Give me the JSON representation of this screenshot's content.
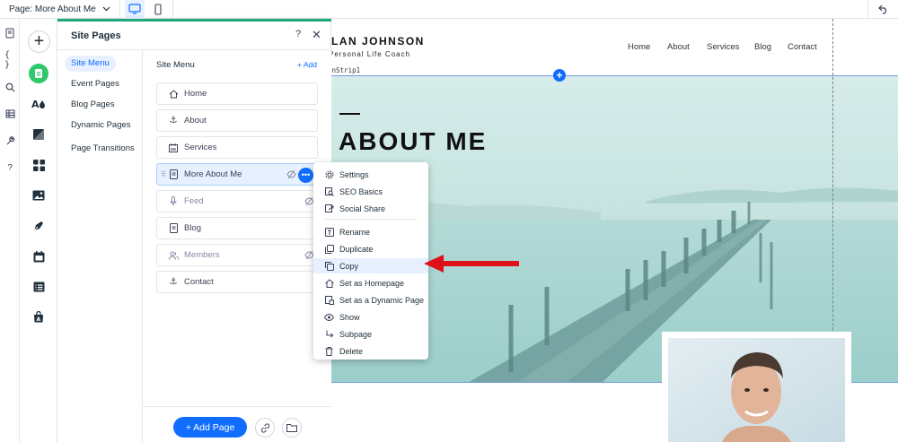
{
  "topbar": {
    "page_label": "Page: More About Me"
  },
  "panel": {
    "title": "Site Pages",
    "help": "?",
    "close": "✕",
    "nav": [
      {
        "label": "Site Menu",
        "active": true
      },
      {
        "label": "Event Pages"
      },
      {
        "label": "Blog Pages"
      },
      {
        "label": "Dynamic Pages"
      },
      {
        "label": "Page Transitions"
      }
    ],
    "main_heading": "Site Menu",
    "add_link": "+ Add",
    "pages": [
      {
        "label": "Home",
        "icon": "home-icon"
      },
      {
        "label": "About",
        "icon": "anchor-icon"
      },
      {
        "label": "Services",
        "icon": "calendar-icon"
      },
      {
        "label": "More About Me",
        "icon": "page-icon",
        "selected": true
      },
      {
        "label": "Feed",
        "icon": "mic-icon",
        "hidden": true
      },
      {
        "label": "Blog",
        "icon": "page-icon"
      },
      {
        "label": "Members",
        "icon": "members-icon",
        "hidden": true
      },
      {
        "label": "Contact",
        "icon": "anchor-icon"
      }
    ],
    "add_page_button": "+ Add Page"
  },
  "context_menu": {
    "items": [
      {
        "label": "Settings",
        "icon": "gear-icon"
      },
      {
        "label": "SEO Basics",
        "icon": "seo-icon"
      },
      {
        "label": "Social Share",
        "icon": "share-icon"
      },
      {
        "label": "Rename",
        "icon": "rename-icon"
      },
      {
        "label": "Duplicate",
        "icon": "duplicate-icon"
      },
      {
        "label": "Copy",
        "icon": "copy-icon",
        "highlighted": true
      },
      {
        "label": "Set as Homepage",
        "icon": "home-icon"
      },
      {
        "label": "Set as a Dynamic Page",
        "icon": "dynamic-page-icon"
      },
      {
        "label": "Show",
        "icon": "eye-icon"
      },
      {
        "label": "Subpage",
        "icon": "subpage-icon"
      },
      {
        "label": "Delete",
        "icon": "trash-icon"
      }
    ]
  },
  "canvas": {
    "site_name": "LAN JOHNSON",
    "site_subtitle": "Personal Life Coach",
    "nav": [
      "Home",
      "About",
      "Services",
      "Blog",
      "Contact"
    ],
    "strip_label": "enStrip1",
    "hero_title": "ABOUT ME"
  },
  "colors": {
    "accent": "#116dff",
    "panel_accent": "#1fa87a",
    "pages_active": "#2fc86b",
    "arrow": "#e0101b"
  }
}
